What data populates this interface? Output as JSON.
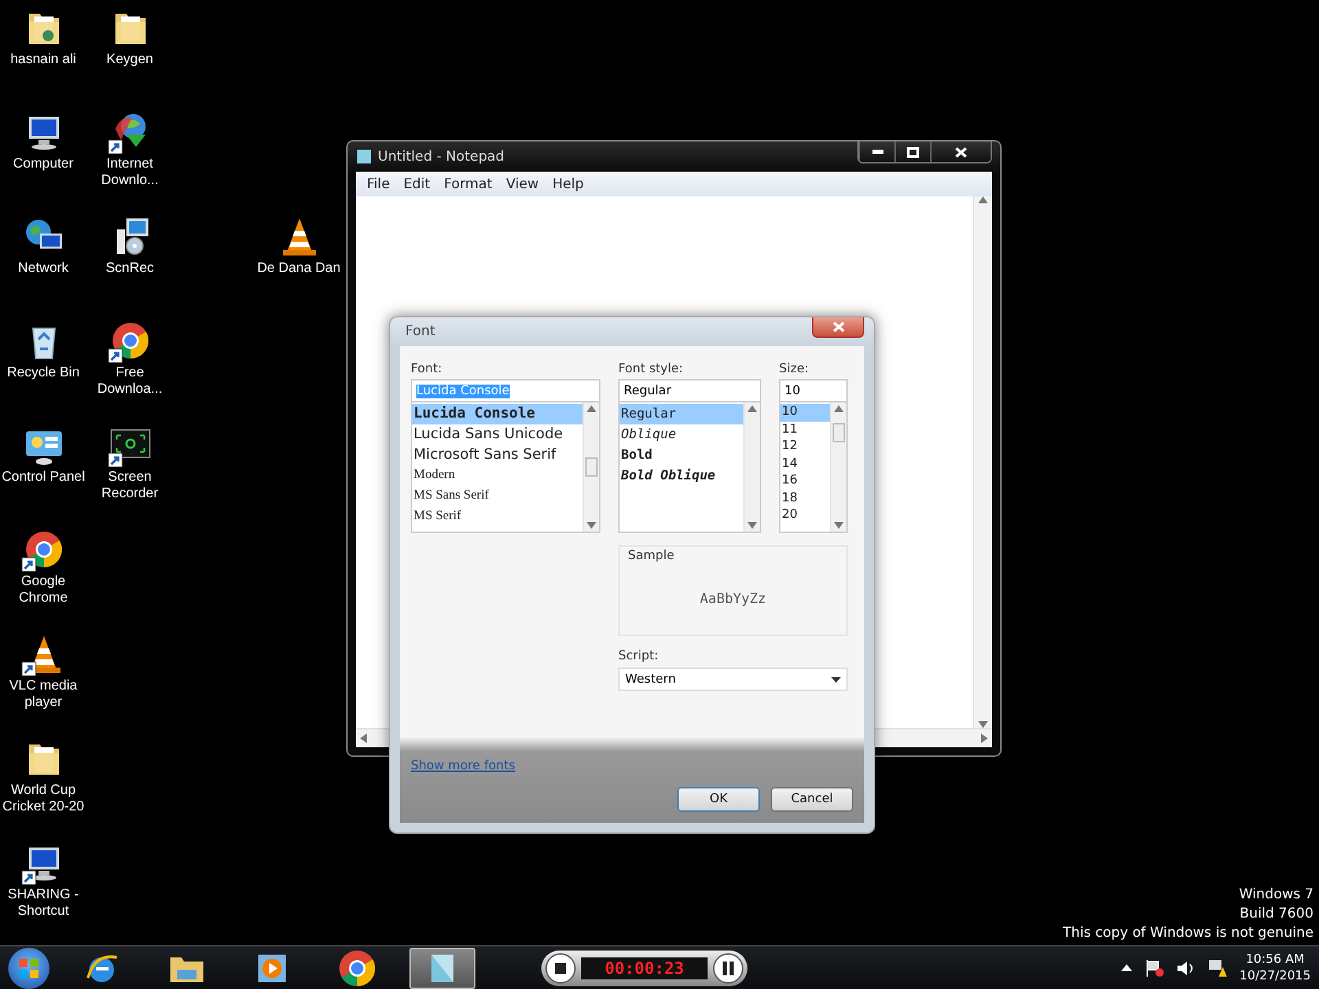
{
  "desktop_columns": [
    [
      {
        "label": "hasnain ali",
        "kind": "folder-person",
        "shortcut": false
      },
      {
        "label": "Computer",
        "kind": "computer",
        "shortcut": false
      },
      {
        "label": "Network",
        "kind": "network",
        "shortcut": false
      },
      {
        "label": "Recycle Bin",
        "kind": "recycle",
        "shortcut": false
      },
      {
        "label": "Control Panel",
        "kind": "control-panel",
        "shortcut": false
      },
      {
        "label": "Google Chrome",
        "kind": "chrome",
        "shortcut": true
      },
      {
        "label": "VLC media player",
        "kind": "vlc",
        "shortcut": true
      },
      {
        "label": "World Cup Cricket 20-20",
        "kind": "folder",
        "shortcut": false
      },
      {
        "label": "SHARING - Shortcut",
        "kind": "computer",
        "shortcut": true
      }
    ],
    [
      {
        "label": "Keygen",
        "kind": "folder",
        "shortcut": false
      },
      {
        "label": "Internet Downlo...",
        "kind": "globe-arrow",
        "shortcut": true
      },
      {
        "label": "ScnRec",
        "kind": "installer",
        "shortcut": false
      },
      {
        "label": "Free Downloa...",
        "kind": "chrome",
        "shortcut": true
      },
      {
        "label": "Screen Recorder",
        "kind": "screen-recorder",
        "shortcut": true
      }
    ]
  ],
  "loose_icon": {
    "label": "De Dana Dan",
    "kind": "vlc",
    "shortcut": false
  },
  "notepad": {
    "title": "Untitled - Notepad",
    "menu": [
      "File",
      "Edit",
      "Format",
      "View",
      "Help"
    ]
  },
  "font_dialog": {
    "title": "Font",
    "font": {
      "label": "Font:",
      "value": "Lucida Console",
      "items": [
        {
          "text": "Lucida Console",
          "selected": true
        },
        {
          "text": "Lucida Sans Unicode",
          "selected": false
        },
        {
          "text": "Microsoft Sans Serif",
          "selected": false
        },
        {
          "text": "Modern",
          "selected": false
        },
        {
          "text": "MS Sans Serif",
          "selected": false
        },
        {
          "text": "MS Serif",
          "selected": false
        }
      ]
    },
    "style": {
      "label": "Font style:",
      "value": "Regular",
      "items": [
        {
          "text": "Regular",
          "kind": "regular",
          "selected": true
        },
        {
          "text": "Oblique",
          "kind": "oblique",
          "selected": false
        },
        {
          "text": "Bold",
          "kind": "bold",
          "selected": false
        },
        {
          "text": "Bold Oblique",
          "kind": "bold-oblique",
          "selected": false
        }
      ]
    },
    "size": {
      "label": "Size:",
      "value": "10",
      "items": [
        {
          "text": "10",
          "selected": true
        },
        {
          "text": "11",
          "selected": false
        },
        {
          "text": "12",
          "selected": false
        },
        {
          "text": "14",
          "selected": false
        },
        {
          "text": "16",
          "selected": false
        },
        {
          "text": "18",
          "selected": false
        },
        {
          "text": "20",
          "selected": false
        }
      ]
    },
    "sample": {
      "label": "Sample",
      "text": "AaBbYyZz"
    },
    "script": {
      "label": "Script:",
      "value": "Western"
    },
    "link": "Show more fonts",
    "buttons": [
      "OK",
      "Cancel"
    ]
  },
  "taskbar": {
    "apps": [
      {
        "kind": "ie",
        "selected": false
      },
      {
        "kind": "explorer",
        "selected": false
      },
      {
        "kind": "media",
        "selected": false
      },
      {
        "kind": "chrome",
        "selected": false
      },
      {
        "kind": "notepad",
        "selected": true
      }
    ],
    "recorder_time": "00:00:23",
    "clock": {
      "time": "10:56 AM",
      "date": "10/27/2015"
    }
  },
  "genuine_notice": [
    "Windows 7",
    "Build 7600",
    "This copy of Windows is not genuine"
  ]
}
